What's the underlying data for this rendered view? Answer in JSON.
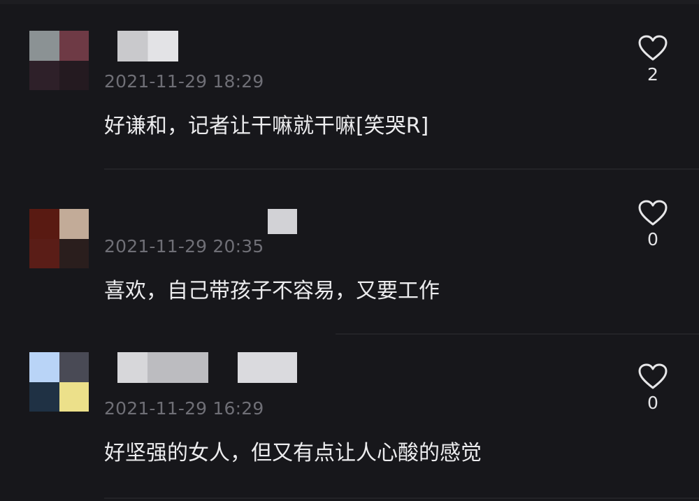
{
  "comments": [
    {
      "timestamp": "2021-11-29 18:29",
      "text": "好谦和，记者让干嘛就干嘛[笑哭R]",
      "likes": "2",
      "avatar_colors": [
        "#8b9294",
        "#6e3a45",
        "#2e2029",
        "#241a20"
      ]
    },
    {
      "timestamp": "2021-11-29 20:35",
      "text": "喜欢，自己带孩子不容易，又要工作",
      "likes": "0",
      "avatar_colors": [
        "#591a12",
        "#c2ab98",
        "#5a1d17",
        "#2a1e1d"
      ]
    },
    {
      "timestamp": "2021-11-29 16:29",
      "text": "好坚强的女人，但又有点让人心酸的感觉",
      "likes": "0",
      "avatar_colors": [
        "#b9d4f7",
        "#494a55",
        "#1f3144",
        "#ece08a"
      ]
    }
  ]
}
